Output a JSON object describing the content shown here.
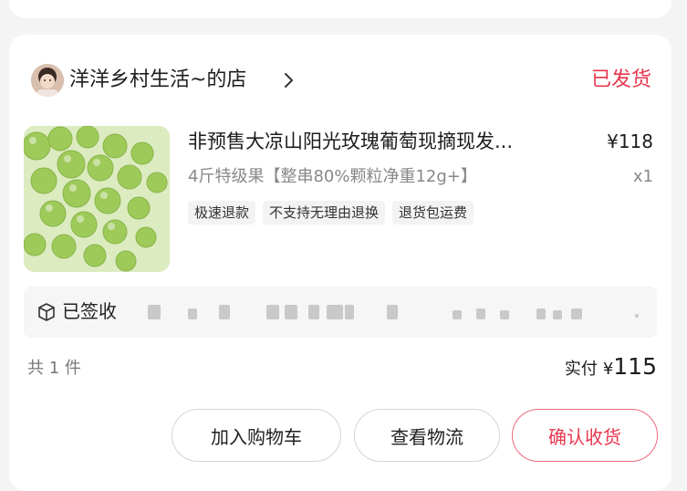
{
  "shop": {
    "name": "洋洋乡村生活~的店",
    "order_status": "已发货"
  },
  "product": {
    "title": "非预售大凉山阳光玫瑰葡萄现摘现发...",
    "price": "¥118",
    "spec": "4斤特级果【整串80%颗粒净重12g+】",
    "quantity": "x1",
    "tags": [
      "极速退款",
      "不支持无理由退换",
      "退货包运费"
    ]
  },
  "logistics": {
    "status": "已签收"
  },
  "summary": {
    "count": "共 1 件",
    "paid_label": "实付",
    "currency": "¥",
    "paid_amount": "115"
  },
  "actions": {
    "add_cart": "加入购物车",
    "view_logistics": "查看物流",
    "confirm_receipt": "确认收货"
  },
  "colors": {
    "accent": "#e8374f",
    "background": "#f4f4f4"
  }
}
